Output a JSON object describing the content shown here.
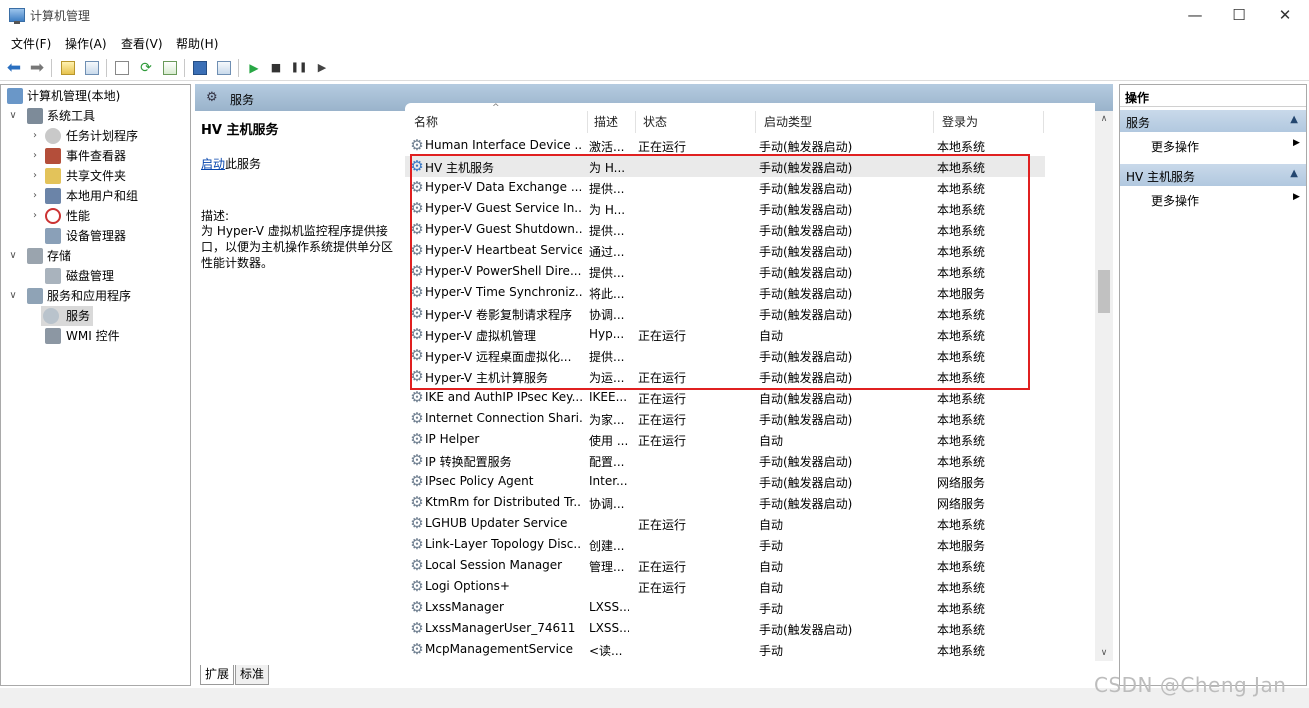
{
  "window": {
    "title": "计算机管理",
    "minimize": "—",
    "maximize": "☐",
    "close": "✕"
  },
  "menu": [
    "文件(F)",
    "操作(A)",
    "查看(V)",
    "帮助(H)"
  ],
  "toolbar": {
    "icons": [
      "back-arrow-icon",
      "forward-arrow-icon",
      "up-folder-icon",
      "show-hide-tree-icon",
      "properties-icon",
      "refresh-icon",
      "export-list-icon",
      "help-icon",
      "show-action-pane-icon",
      "play-icon",
      "stop-icon",
      "pause-icon",
      "resume-icon"
    ],
    "play": "▶",
    "stop": "■",
    "pause": "❚❚",
    "resume": "▶"
  },
  "tree": {
    "root": "计算机管理(本地)",
    "items": [
      {
        "label": "系统工具",
        "level": 1,
        "expanded": true
      },
      {
        "label": "任务计划程序",
        "level": 2,
        "expanded": false
      },
      {
        "label": "事件查看器",
        "level": 2,
        "expanded": false
      },
      {
        "label": "共享文件夹",
        "level": 2,
        "expanded": false
      },
      {
        "label": "本地用户和组",
        "level": 2,
        "expanded": false
      },
      {
        "label": "性能",
        "level": 2,
        "expanded": false
      },
      {
        "label": "设备管理器",
        "level": 2
      },
      {
        "label": "存储",
        "level": 1,
        "expanded": true
      },
      {
        "label": "磁盘管理",
        "level": 2
      },
      {
        "label": "服务和应用程序",
        "level": 1,
        "expanded": true
      },
      {
        "label": "服务",
        "level": 2,
        "selected": true
      },
      {
        "label": "WMI 控件",
        "level": 2
      }
    ]
  },
  "services_header": "服务",
  "details": {
    "title": "HV 主机服务",
    "start_link": "启动",
    "start_suffix": "此服务",
    "description_label": "描述:",
    "description": "为 Hyper-V 虚拟机监控程序提供接口，以便为主机操作系统提供单分区性能计数器。"
  },
  "columns": {
    "name": "名称",
    "description": "描述",
    "status": "状态",
    "startup": "启动类型",
    "logon": "登录为"
  },
  "services": [
    {
      "name": "Human Interface Device ...",
      "desc": "激活...",
      "status": "正在运行",
      "startup": "手动(触发器启动)",
      "logon": "本地系统"
    },
    {
      "name": "HV 主机服务",
      "desc": "为 H...",
      "status": "",
      "startup": "手动(触发器启动)",
      "logon": "本地系统",
      "selected": true
    },
    {
      "name": "Hyper-V Data Exchange ...",
      "desc": "提供...",
      "status": "",
      "startup": "手动(触发器启动)",
      "logon": "本地系统"
    },
    {
      "name": "Hyper-V Guest Service In...",
      "desc": "为 H...",
      "status": "",
      "startup": "手动(触发器启动)",
      "logon": "本地系统"
    },
    {
      "name": "Hyper-V Guest Shutdown...",
      "desc": "提供...",
      "status": "",
      "startup": "手动(触发器启动)",
      "logon": "本地系统"
    },
    {
      "name": "Hyper-V Heartbeat Service",
      "desc": "通过...",
      "status": "",
      "startup": "手动(触发器启动)",
      "logon": "本地系统"
    },
    {
      "name": "Hyper-V PowerShell Dire...",
      "desc": "提供...",
      "status": "",
      "startup": "手动(触发器启动)",
      "logon": "本地系统"
    },
    {
      "name": "Hyper-V Time Synchroniz...",
      "desc": "将此...",
      "status": "",
      "startup": "手动(触发器启动)",
      "logon": "本地服务"
    },
    {
      "name": "Hyper-V 卷影复制请求程序",
      "desc": "协调...",
      "status": "",
      "startup": "手动(触发器启动)",
      "logon": "本地系统"
    },
    {
      "name": "Hyper-V 虚拟机管理",
      "desc": "Hyp...",
      "status": "正在运行",
      "startup": "自动",
      "logon": "本地系统"
    },
    {
      "name": "Hyper-V 远程桌面虚拟化...",
      "desc": "提供...",
      "status": "",
      "startup": "手动(触发器启动)",
      "logon": "本地系统"
    },
    {
      "name": "Hyper-V 主机计算服务",
      "desc": "为运...",
      "status": "正在运行",
      "startup": "手动(触发器启动)",
      "logon": "本地系统"
    },
    {
      "name": "IKE and AuthIP IPsec Key...",
      "desc": "IKEE...",
      "status": "正在运行",
      "startup": "自动(触发器启动)",
      "logon": "本地系统"
    },
    {
      "name": "Internet Connection Shari...",
      "desc": "为家...",
      "status": "正在运行",
      "startup": "手动(触发器启动)",
      "logon": "本地系统"
    },
    {
      "name": "IP Helper",
      "desc": "使用 ...",
      "status": "正在运行",
      "startup": "自动",
      "logon": "本地系统"
    },
    {
      "name": "IP 转换配置服务",
      "desc": "配置...",
      "status": "",
      "startup": "手动(触发器启动)",
      "logon": "本地系统"
    },
    {
      "name": "IPsec Policy Agent",
      "desc": "Inter...",
      "status": "",
      "startup": "手动(触发器启动)",
      "logon": "网络服务"
    },
    {
      "name": "KtmRm for Distributed Tr...",
      "desc": "协调...",
      "status": "",
      "startup": "手动(触发器启动)",
      "logon": "网络服务"
    },
    {
      "name": "LGHUB Updater Service",
      "desc": "",
      "status": "正在运行",
      "startup": "自动",
      "logon": "本地系统"
    },
    {
      "name": "Link-Layer Topology Disc...",
      "desc": "创建...",
      "status": "",
      "startup": "手动",
      "logon": "本地服务"
    },
    {
      "name": "Local Session Manager",
      "desc": "管理...",
      "status": "正在运行",
      "startup": "自动",
      "logon": "本地系统"
    },
    {
      "name": "Logi Options+",
      "desc": "",
      "status": "正在运行",
      "startup": "自动",
      "logon": "本地系统"
    },
    {
      "name": "LxssManager",
      "desc": "LXSS...",
      "status": "",
      "startup": "手动",
      "logon": "本地系统"
    },
    {
      "name": "LxssManagerUser_74611",
      "desc": "LXSS...",
      "status": "",
      "startup": "手动(触发器启动)",
      "logon": "本地系统"
    },
    {
      "name": "McpManagementService",
      "desc": "<读...",
      "status": "",
      "startup": "手动",
      "logon": "本地系统"
    }
  ],
  "tabs": [
    "扩展",
    "标准"
  ],
  "actions": {
    "header": "操作",
    "section1": "服务",
    "more1": "更多操作",
    "section2": "HV 主机服务",
    "more2": "更多操作",
    "caret": "▲",
    "submenu": "▶"
  },
  "watermark": "CSDN @Cheng Jan",
  "colors": {
    "highlight_border": "#e02020",
    "header_blue": "#9ab3cb",
    "link": "#0645ad"
  }
}
